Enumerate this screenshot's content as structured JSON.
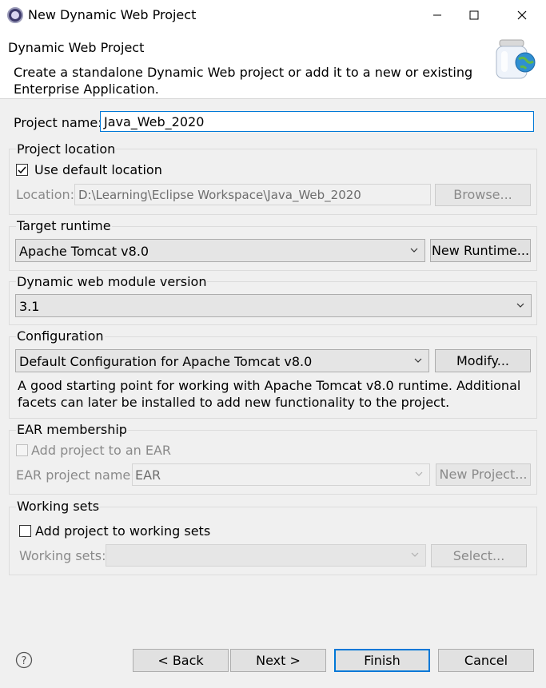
{
  "window": {
    "title": "New Dynamic Web Project",
    "controls": [
      "minimize-icon",
      "maximize-icon",
      "close-icon"
    ]
  },
  "header": {
    "title": "Dynamic Web Project",
    "description_line1": "Create a standalone Dynamic Web project or add it to a new or existing",
    "description_line2": "Enterprise Application."
  },
  "project_name": {
    "label": "Project name:",
    "value": "Java_Web_2020"
  },
  "project_location": {
    "group_label": "Project location",
    "use_default_label": "Use default location",
    "use_default_checked": true,
    "location_label": "Location:",
    "location_value": "D:\\Learning\\Eclipse Workspace\\Java_Web_2020",
    "browse_label": "Browse..."
  },
  "target_runtime": {
    "group_label": "Target runtime",
    "selected": "Apache Tomcat v8.0",
    "new_runtime_label": "New Runtime..."
  },
  "module_version": {
    "group_label": "Dynamic web module version",
    "selected": "3.1"
  },
  "configuration": {
    "group_label": "Configuration",
    "selected": "Default Configuration for Apache Tomcat v8.0",
    "modify_label": "Modify...",
    "description_line1": "A good starting point for working with Apache Tomcat v8.0 runtime. Additional",
    "description_line2": "facets can later be installed to add new functionality to the project."
  },
  "ear_membership": {
    "group_label": "EAR membership",
    "add_label": "Add project to an EAR",
    "add_checked": false,
    "ear_name_label": "EAR project name:",
    "ear_name_value": "EAR",
    "new_project_label": "New Project..."
  },
  "working_sets": {
    "group_label": "Working sets",
    "add_label": "Add project to working sets",
    "add_checked": false,
    "sets_label": "Working sets:",
    "sets_value": "",
    "select_label": "Select..."
  },
  "footer": {
    "help_icon": "help-icon",
    "back_label": "< Back",
    "next_label": "Next >",
    "finish_label": "Finish",
    "cancel_label": "Cancel"
  },
  "colors": {
    "focus_border": "#0078d7",
    "dialog_background": "#f0f0f0",
    "button_face": "#e1e1e1"
  }
}
